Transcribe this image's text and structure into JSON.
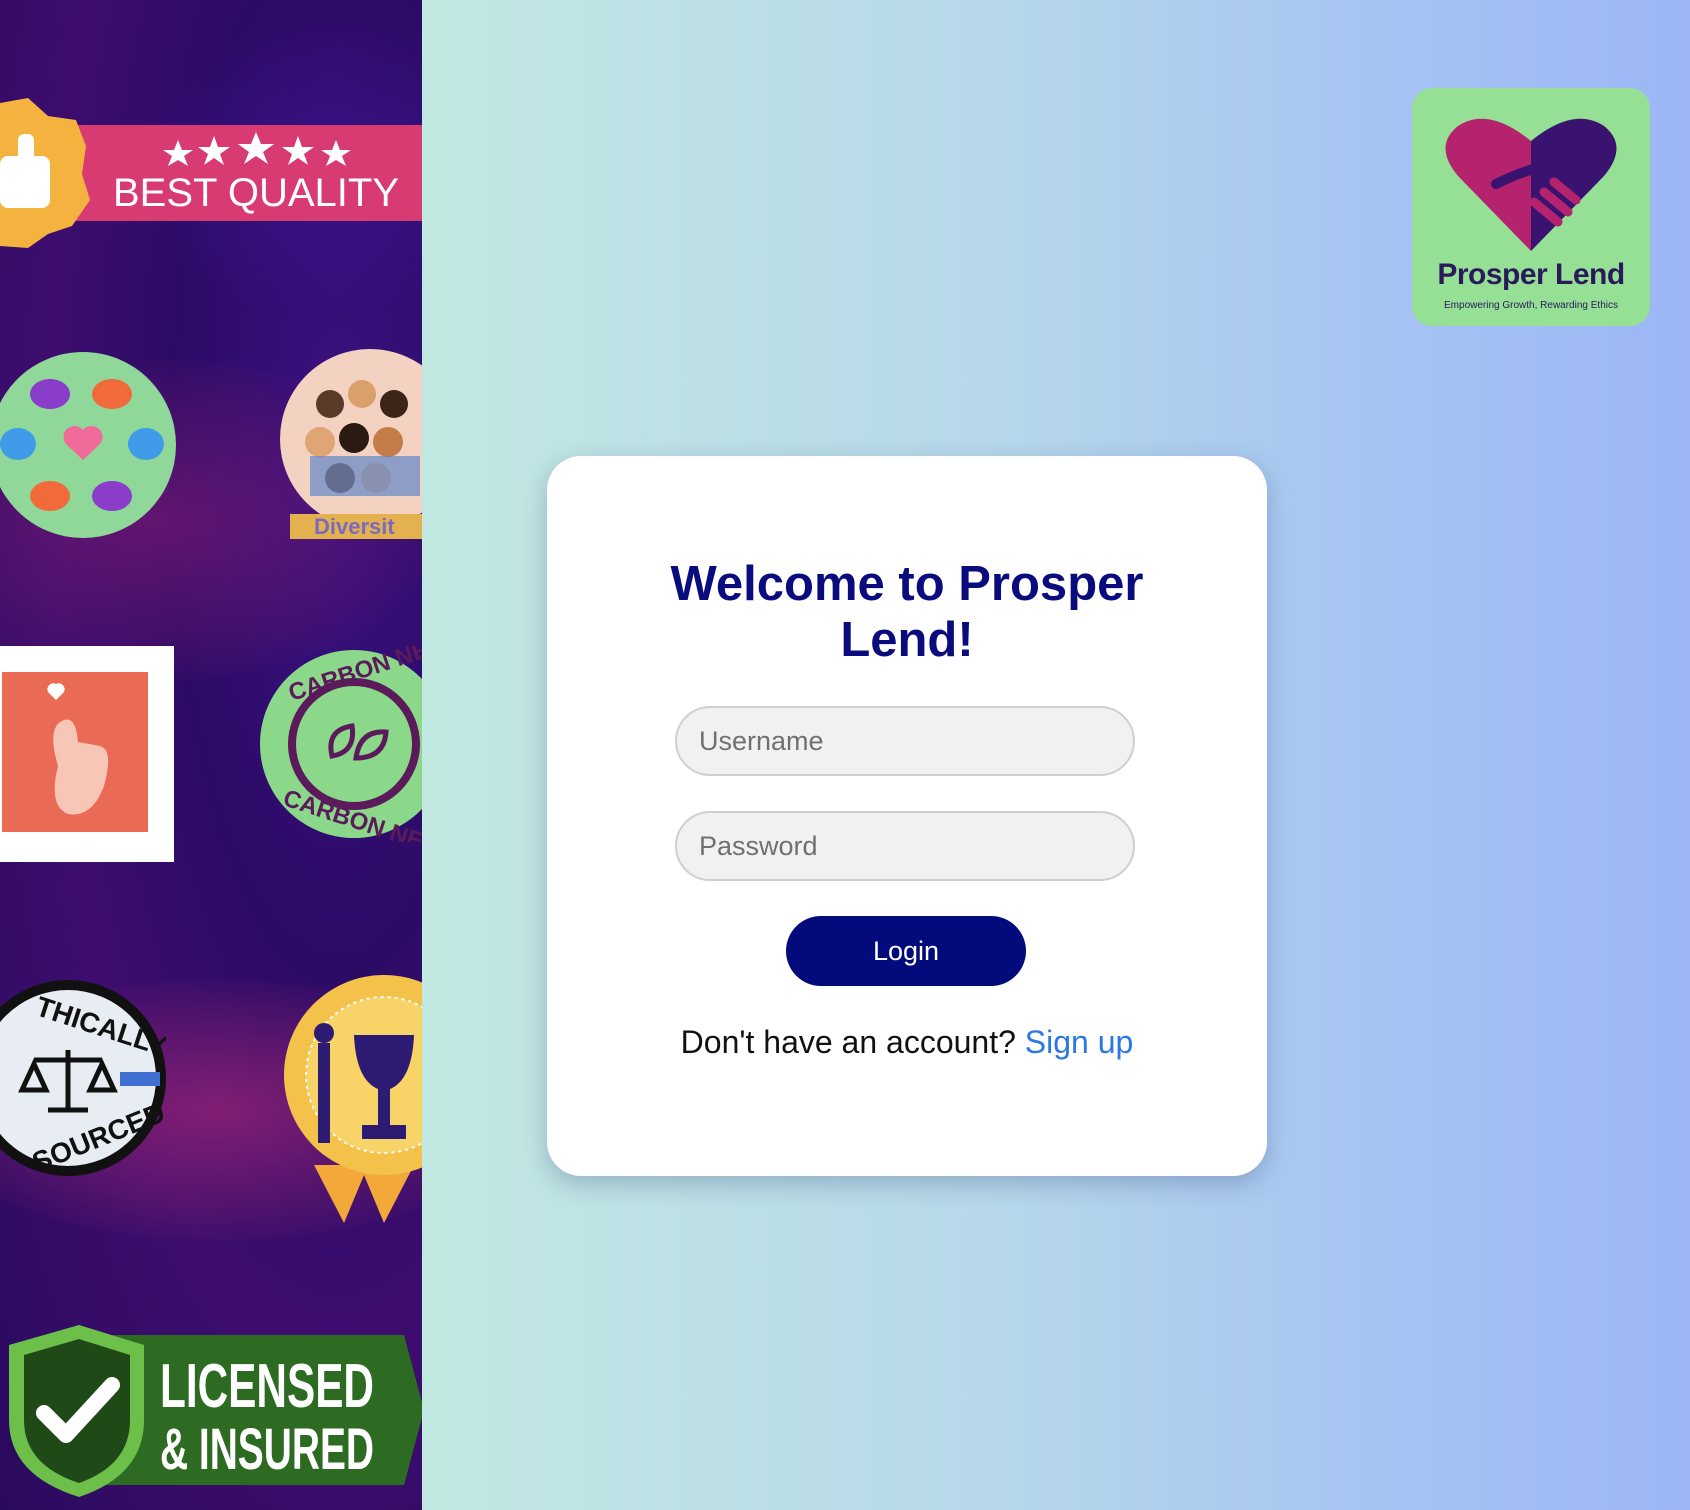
{
  "badges": {
    "best_quality": "BEST QUALITY",
    "diversity": "Diversit",
    "carbon_top": "CARBON NEU",
    "carbon_bottom": "CARBON NEU",
    "ethically": "THICALLY",
    "sourced": "SOURCED",
    "licensed_line1": "LICENSED",
    "licensed_line2": "& INSURED"
  },
  "logo": {
    "title": "Prosper Lend",
    "tagline": "Empowering Growth, Rewarding Ethics"
  },
  "login": {
    "title": "Welcome to Prosper Lend!",
    "username_placeholder": "Username",
    "password_placeholder": "Password",
    "button_label": "Login",
    "signup_prompt": "Don't have an account?",
    "signup_link": "Sign up"
  },
  "colors": {
    "title": "#0a0c7e",
    "button": "#030b7c",
    "link": "#2b78e4",
    "logo_bg": "#95e095",
    "left_panel": "#2c0b66"
  }
}
